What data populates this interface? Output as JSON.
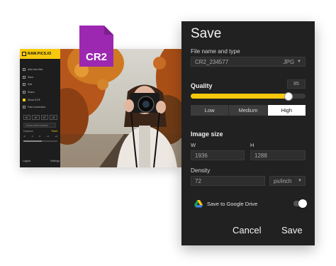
{
  "app": {
    "logo": "RAW.PICS.IO",
    "menu": [
      {
        "label": "Add new files",
        "active": false
      },
      {
        "label": "Save",
        "active": false
      },
      {
        "label": "Edit",
        "active": false
      },
      {
        "label": "Share",
        "active": false
      },
      {
        "label": "Show EXIF",
        "active": true
      },
      {
        "label": "Fast conversion",
        "active": false
      }
    ],
    "rotate_buttons": [
      "90°",
      "-90°",
      "90°",
      "-90°"
    ],
    "white_balance_placeholder": "Camera white balance",
    "exposure_label": "Exposure",
    "exposure_reset": "Reset",
    "exposure_stops": [
      "-2",
      "-1",
      "0",
      "+1",
      "+2"
    ],
    "exposure_level": 0.54,
    "footer": {
      "logout": "Logout",
      "settings": "Settings"
    }
  },
  "badge": {
    "label": "CR2",
    "color": "#9c27b0"
  },
  "dialog": {
    "title": "Save",
    "file_section_label": "File name and type",
    "file_name": "CR2_234577",
    "file_type": "JPG",
    "quality_label": "Quality",
    "quality_value": "85",
    "quality_level": 0.85,
    "quality_options": [
      "Low",
      "Medium",
      "High"
    ],
    "quality_selected": "High",
    "image_size_label": "Image size",
    "width_label": "W",
    "width_value": "1936",
    "height_label": "H",
    "height_value": "1288",
    "density_label": "Density",
    "density_value": "72",
    "density_unit": "px/inch",
    "drive_label": "Save to Google Drive",
    "drive_enabled": false,
    "cancel_label": "Cancel",
    "save_label": "Save"
  },
  "colors": {
    "accent": "#f6c90e",
    "dialog_bg": "#212121",
    "badge": "#9c27b0"
  }
}
